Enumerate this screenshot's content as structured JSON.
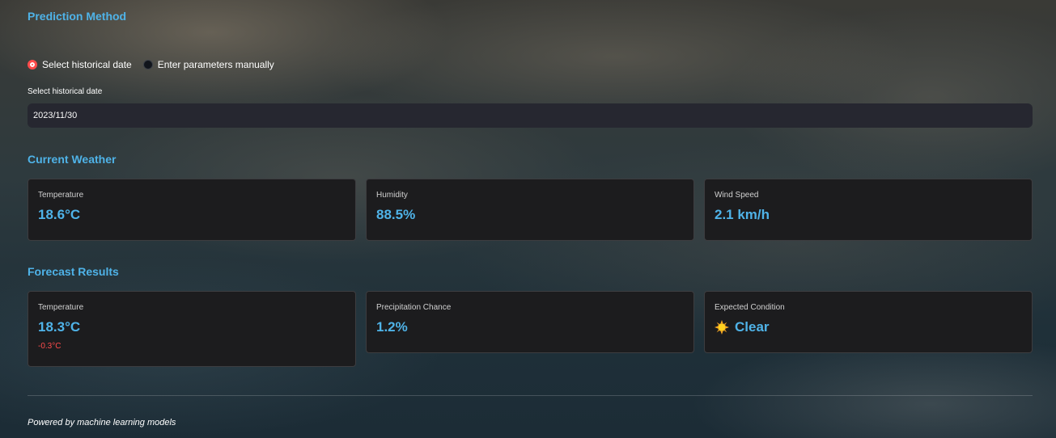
{
  "prediction_method": {
    "title": "Prediction Method",
    "options": [
      {
        "label": "Select historical date",
        "selected": true
      },
      {
        "label": "Enter parameters manually",
        "selected": false
      }
    ],
    "date_label": "Select historical date",
    "date_value": "2023/11/30"
  },
  "current_weather": {
    "title": "Current Weather",
    "cards": [
      {
        "label": "Temperature",
        "value": "18.6°C"
      },
      {
        "label": "Humidity",
        "value": "88.5%"
      },
      {
        "label": "Wind Speed",
        "value": "2.1 km/h"
      }
    ]
  },
  "forecast": {
    "title": "Forecast Results",
    "cards": [
      {
        "label": "Temperature",
        "value": "18.3°C",
        "delta": "-0.3°C"
      },
      {
        "label": "Precipitation Chance",
        "value": "1.2%"
      },
      {
        "label": "Expected Condition",
        "value": "Clear",
        "icon": "sun-icon"
      }
    ]
  },
  "footer": "Powered by machine learning models",
  "colors": {
    "accent": "#4fb3e8",
    "radio_selected": "#ff4b4b",
    "delta_negative": "#ff4b4b",
    "card_bg": "#1c1c1e",
    "input_bg": "#262730"
  }
}
